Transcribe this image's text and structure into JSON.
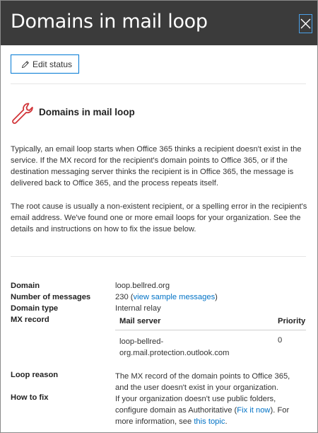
{
  "header": {
    "title": "Domains in mail loop",
    "close_label": "Close"
  },
  "toolbar": {
    "edit_label": "Edit status"
  },
  "section": {
    "title": "Domains in mail loop"
  },
  "description": {
    "p1": "Typically, an email loop starts when Office 365 thinks a recipient doesn't exist in the service. If the MX record for the recipient's domain points to Office 365, or if the destination messaging server thinks the recipient is in Office 365, the message is delivered back to Office 365, and the process repeats itself.",
    "p2": "The root cause is usually a non-existent recipient, or a spelling error in the recipient's email address. We've found one or more email loops for your organization. See the details and instructions on how to fix the issue below."
  },
  "details": {
    "domain_label": "Domain",
    "domain_value": "loop.bellred.org",
    "messages_label": "Number of messages",
    "messages_count": "230",
    "messages_link": "view sample messages",
    "type_label": "Domain type",
    "type_value": "Internal relay",
    "mx_label": "MX record",
    "mx_table": {
      "col_server": "Mail server",
      "col_priority": "Priority",
      "server_line1": "loop-bellred-",
      "server_line2": "org.mail.protection.outlook.com",
      "priority": "0"
    },
    "reason_label": "Loop reason",
    "reason_line1": "The MX record of the domain points to Office 365,",
    "reason_line2": "and the user doesn't exist in your organization.",
    "fix_label": "How to fix",
    "fix_line1": "If your organization doesn't use public folders,",
    "fix_line2_prefix": "configure domain as Authoritative (",
    "fix_link1": "Fix it now",
    "fix_line2_suffix": "). For",
    "fix_line3_prefix": "more information, see ",
    "fix_link2": "this topic",
    "fix_line3_suffix": "."
  },
  "colors": {
    "header_bg": "#3b3b3b",
    "accent": "#0078d4",
    "link": "#0072c6",
    "icon_red": "#d13438"
  },
  "icons": {
    "close": "close-icon",
    "edit": "pencil-icon",
    "section": "wrench-icon"
  }
}
